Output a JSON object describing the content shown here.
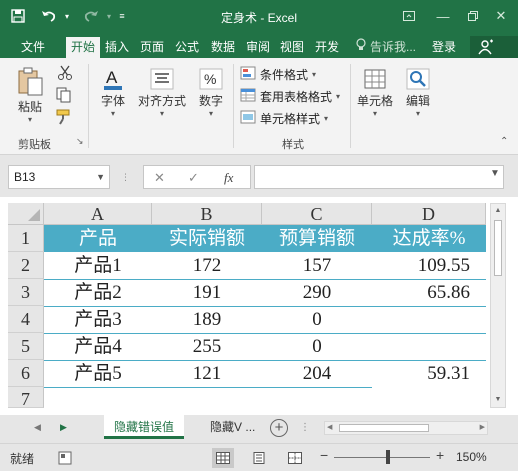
{
  "window": {
    "title": "定身术 - Excel",
    "colors": {
      "brand": "#217346",
      "table_header": "#4bacc6"
    }
  },
  "ribbon_tabs": [
    {
      "label": "文件",
      "active": false
    },
    {
      "label": "开始",
      "active": true
    },
    {
      "label": "插入",
      "active": false
    },
    {
      "label": "页面",
      "active": false
    },
    {
      "label": "公式",
      "active": false
    },
    {
      "label": "数据",
      "active": false
    },
    {
      "label": "审阅",
      "active": false
    },
    {
      "label": "视图",
      "active": false
    },
    {
      "label": "开发",
      "active": false
    }
  ],
  "tell_me": "告诉我...",
  "login": "登录",
  "ribbon": {
    "paste": "粘贴",
    "font": "字体",
    "alignment": "对齐方式",
    "number": "数字",
    "conditional_format": "条件格式",
    "format_as_table": "套用表格格式",
    "cell_styles": "单元格样式",
    "cells": "单元格",
    "editing": "编辑",
    "group_clipboard": "剪贴板",
    "group_styles": "样式"
  },
  "formula_bar": {
    "name_box": "B13",
    "formula": ""
  },
  "columns": [
    "A",
    "B",
    "C",
    "D"
  ],
  "rows": [
    "1",
    "2",
    "3",
    "4",
    "5",
    "6",
    "7"
  ],
  "table": {
    "headers": [
      "产品",
      "实际销额",
      "预算销额",
      "达成率%"
    ],
    "data": [
      [
        "产品1",
        "172",
        "157",
        "109.55"
      ],
      [
        "产品2",
        "191",
        "290",
        "65.86"
      ],
      [
        "产品3",
        "189",
        "0",
        ""
      ],
      [
        "产品4",
        "255",
        "0",
        ""
      ],
      [
        "产品5",
        "121",
        "204",
        "59.31"
      ]
    ]
  },
  "sheets": {
    "active": "隐藏错误值",
    "other": "隐藏"
  },
  "status": {
    "ready": "就绪",
    "zoom": "150%"
  }
}
